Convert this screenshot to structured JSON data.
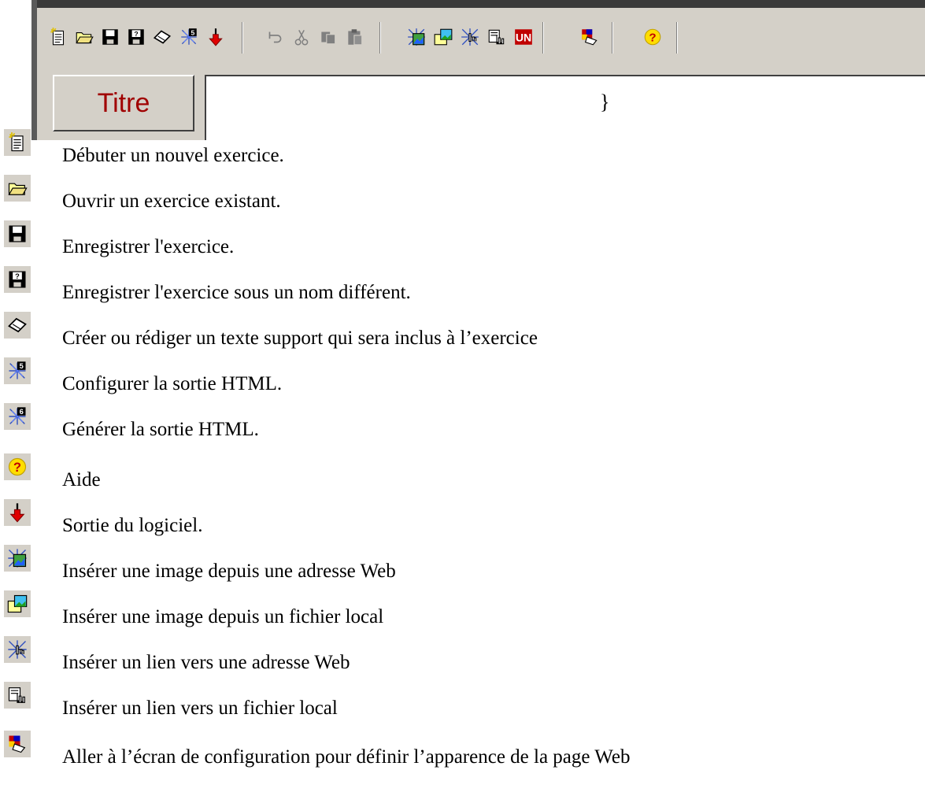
{
  "toolbar": {
    "buttons": [
      {
        "id": "new",
        "icon": "new-document-icon"
      },
      {
        "id": "open",
        "icon": "open-folder-icon"
      },
      {
        "id": "save",
        "icon": "save-disk-icon"
      },
      {
        "id": "save-as",
        "icon": "save-as-disk-icon"
      },
      {
        "id": "text",
        "icon": "eraser-text-icon"
      },
      {
        "id": "config-html",
        "icon": "web-config-5-icon"
      },
      {
        "id": "exit",
        "icon": "red-arrow-down-icon"
      },
      {
        "id": "undo",
        "icon": "undo-icon"
      },
      {
        "id": "cut",
        "icon": "cut-icon"
      },
      {
        "id": "copy",
        "icon": "copy-icon"
      },
      {
        "id": "paste",
        "icon": "paste-icon"
      },
      {
        "id": "web-image",
        "icon": "web-image-icon"
      },
      {
        "id": "local-image",
        "icon": "local-image-icon"
      },
      {
        "id": "web-link",
        "icon": "web-link-icon"
      },
      {
        "id": "local-link",
        "icon": "local-link-icon"
      },
      {
        "id": "unicode",
        "icon": "unicode-un-icon"
      },
      {
        "id": "appearance",
        "icon": "appearance-config-icon"
      },
      {
        "id": "help",
        "icon": "help-icon"
      }
    ]
  },
  "title_button": {
    "label": "Titre"
  },
  "editor": {
    "content": "}"
  },
  "legend": [
    {
      "icon": "new-document-icon",
      "text": "Débuter un nouvel exercice."
    },
    {
      "icon": "open-folder-icon",
      "text": "Ouvrir un exercice existant."
    },
    {
      "icon": "save-disk-icon",
      "text": "Enregistrer l'exercice."
    },
    {
      "icon": "save-as-disk-icon",
      "text": "Enregistrer l'exercice sous un nom différent."
    },
    {
      "icon": "eraser-text-icon",
      "text": "Créer ou rédiger un texte support qui sera inclus à l’exercice"
    },
    {
      "icon": "web-config-5-icon",
      "text": "Configurer la sortie HTML."
    },
    {
      "icon": "web-generate-6-icon",
      "text": "Générer la sortie HTML."
    },
    {
      "icon": "help-icon",
      "text": "Aide"
    },
    {
      "icon": "red-arrow-down-icon",
      "text": "Sortie du logiciel."
    },
    {
      "icon": "web-image-icon",
      "text": "Insérer une image depuis une adresse Web"
    },
    {
      "icon": "local-image-icon",
      "text": "Insérer une image depuis un fichier local"
    },
    {
      "icon": "web-link-icon",
      "text": "Insérer un lien vers une adresse Web"
    },
    {
      "icon": "local-link-icon",
      "text": "Insérer un lien vers un fichier local"
    },
    {
      "icon": "appearance-config-icon",
      "text": "Aller à l’écran de configuration pour définir l’apparence de la page Web"
    }
  ],
  "colors": {
    "face": "#d4d0c8",
    "title_text": "#a00000"
  }
}
